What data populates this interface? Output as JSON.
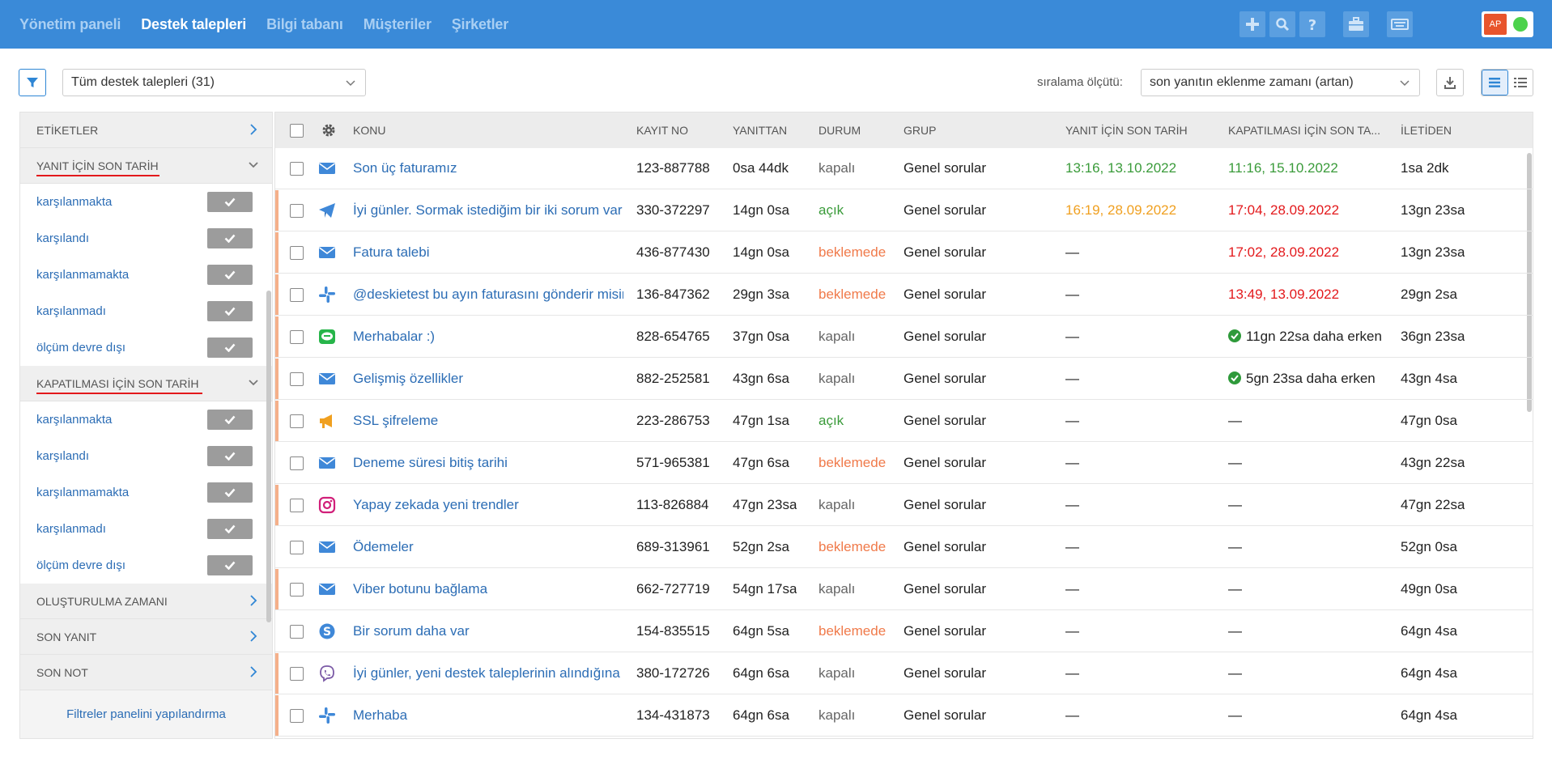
{
  "nav": {
    "items": [
      "Yönetim paneli",
      "Destek talepleri",
      "Bilgi tabanı",
      "Müşteriler",
      "Şirketler"
    ],
    "active_index": 1
  },
  "header_icons": [
    "plus-icon",
    "search-icon",
    "help-icon",
    "briefcase-icon",
    "keyboard-icon"
  ],
  "user": {
    "initials": "AP",
    "status": "online"
  },
  "filter_select": {
    "value": "Tüm destek talepleri (31)"
  },
  "sort": {
    "label": "sıralama ölçütü:",
    "value": "son yanıtın eklenme zamanı (artan)"
  },
  "sidebar": {
    "sections": [
      {
        "title": "ETİKETLER",
        "expanded": false,
        "underlined": false
      },
      {
        "title": "YANIT İÇİN SON TARİH",
        "expanded": true,
        "underlined": true,
        "items": [
          "karşılanmakta",
          "karşılandı",
          "karşılanmamakta",
          "karşılanmadı",
          "ölçüm devre dışı"
        ]
      },
      {
        "title": "KAPATILMASI İÇİN SON TARİH",
        "expanded": true,
        "underlined": true,
        "items": [
          "karşılanmakta",
          "karşılandı",
          "karşılanmamakta",
          "karşılanmadı",
          "ölçüm devre dışı"
        ]
      },
      {
        "title": "OLUŞTURULMA ZAMANI",
        "expanded": false,
        "underlined": false
      },
      {
        "title": "SON YANIT",
        "expanded": false,
        "underlined": false
      },
      {
        "title": "SON NOT",
        "expanded": false,
        "underlined": false
      }
    ],
    "footer": "Filtreler panelini yapılandırma"
  },
  "table": {
    "headers": {
      "subject": "KONU",
      "id": "KAYIT NO",
      "answered": "YANITTAN",
      "status": "DURUM",
      "group": "GRUP",
      "reply_due": "YANIT İÇİN SON TARİH",
      "close_due": "KAPATILMASI İÇİN SON TA...",
      "updated": "İLETİDEN"
    },
    "colors": {
      "link": "#2c6db5",
      "green": "#3a9b3a",
      "orange": "#f0a020",
      "red": "#e3191c",
      "pending": "#f07a4a",
      "closed": "#666666"
    },
    "rows": [
      {
        "channel": "email-icon",
        "marked": false,
        "subject": "Son üç faturamız",
        "id": "123-887788",
        "answered": "0sa 44dk",
        "status": "kapalı",
        "status_color": "closed",
        "group": "Genel sorular",
        "reply_due": "13:16, 13.10.2022",
        "reply_color": "green",
        "close_due": "11:16, 15.10.2022",
        "close_color": "green",
        "close_ok": false,
        "updated": "1sa 2dk"
      },
      {
        "channel": "telegram-icon",
        "marked": true,
        "subject": "İyi günler. Sormak istediğim bir iki sorum var",
        "id": "330-372297",
        "answered": "14gn 0sa",
        "status": "açık",
        "status_color": "green",
        "group": "Genel sorular",
        "reply_due": "16:19, 28.09.2022",
        "reply_color": "orange",
        "close_due": "17:04, 28.09.2022",
        "close_color": "red",
        "close_ok": false,
        "updated": "13gn 23sa"
      },
      {
        "channel": "email-icon",
        "marked": true,
        "subject": "Fatura talebi",
        "id": "436-877430",
        "answered": "14gn 0sa",
        "status": "beklemede",
        "status_color": "pending",
        "group": "Genel sorular",
        "reply_due": "—",
        "reply_color": "",
        "close_due": "17:02, 28.09.2022",
        "close_color": "red",
        "close_ok": false,
        "updated": "13gn 23sa"
      },
      {
        "channel": "slack-icon",
        "marked": true,
        "subject": "@deskietest bu ayın faturasını gönderir misiniz",
        "id": "136-847362",
        "answered": "29gn 3sa",
        "status": "beklemede",
        "status_color": "pending",
        "group": "Genel sorular",
        "reply_due": "—",
        "reply_color": "",
        "close_due": "13:49, 13.09.2022",
        "close_color": "red",
        "close_ok": false,
        "updated": "29gn 2sa"
      },
      {
        "channel": "line-icon",
        "marked": true,
        "subject": "Merhabalar :)",
        "id": "828-654765",
        "answered": "37gn 0sa",
        "status": "kapalı",
        "status_color": "closed",
        "group": "Genel sorular",
        "reply_due": "—",
        "reply_color": "",
        "close_due": "11gn 22sa daha erken",
        "close_color": "",
        "close_ok": true,
        "updated": "36gn 23sa"
      },
      {
        "channel": "email-icon",
        "marked": true,
        "subject": "Gelişmiş özellikler",
        "id": "882-252581",
        "answered": "43gn 6sa",
        "status": "kapalı",
        "status_color": "closed",
        "group": "Genel sorular",
        "reply_due": "—",
        "reply_color": "",
        "close_due": "5gn 23sa daha erken",
        "close_color": "",
        "close_ok": true,
        "updated": "43gn 4sa"
      },
      {
        "channel": "megaphone-icon",
        "marked": true,
        "subject": "SSL şifreleme",
        "id": "223-286753",
        "answered": "47gn 1sa",
        "status": "açık",
        "status_color": "green",
        "group": "Genel sorular",
        "reply_due": "—",
        "reply_color": "",
        "close_due": "—",
        "close_color": "",
        "close_ok": false,
        "updated": "47gn 0sa"
      },
      {
        "channel": "email-icon",
        "marked": false,
        "subject": "Deneme süresi bitiş tarihi",
        "id": "571-965381",
        "answered": "47gn 6sa",
        "status": "beklemede",
        "status_color": "pending",
        "group": "Genel sorular",
        "reply_due": "—",
        "reply_color": "",
        "close_due": "—",
        "close_color": "",
        "close_ok": false,
        "updated": "43gn 22sa"
      },
      {
        "channel": "instagram-icon",
        "marked": true,
        "subject": "Yapay zekada yeni trendler",
        "id": "113-826884",
        "answered": "47gn 23sa",
        "status": "kapalı",
        "status_color": "closed",
        "group": "Genel sorular",
        "reply_due": "—",
        "reply_color": "",
        "close_due": "—",
        "close_color": "",
        "close_ok": false,
        "updated": "47gn 22sa"
      },
      {
        "channel": "email-icon",
        "marked": false,
        "subject": "Ödemeler",
        "id": "689-313961",
        "answered": "52gn 2sa",
        "status": "beklemede",
        "status_color": "pending",
        "group": "Genel sorular",
        "reply_due": "—",
        "reply_color": "",
        "close_due": "—",
        "close_color": "",
        "close_ok": false,
        "updated": "52gn 0sa"
      },
      {
        "channel": "email-icon",
        "marked": true,
        "subject": "Viber botunu bağlama",
        "id": "662-727719",
        "answered": "54gn 17sa",
        "status": "kapalı",
        "status_color": "closed",
        "group": "Genel sorular",
        "reply_due": "—",
        "reply_color": "",
        "close_due": "—",
        "close_color": "",
        "close_ok": false,
        "updated": "49gn 0sa"
      },
      {
        "channel": "skype-icon",
        "marked": false,
        "subject": "Bir sorum daha var",
        "id": "154-835515",
        "answered": "64gn 5sa",
        "status": "beklemede",
        "status_color": "pending",
        "group": "Genel sorular",
        "reply_due": "—",
        "reply_color": "",
        "close_due": "—",
        "close_color": "",
        "close_ok": false,
        "updated": "64gn 4sa"
      },
      {
        "channel": "viber-icon",
        "marked": true,
        "subject": "İyi günler, yeni destek taleplerinin alındığına dair",
        "id": "380-172726",
        "answered": "64gn 6sa",
        "status": "kapalı",
        "status_color": "closed",
        "group": "Genel sorular",
        "reply_due": "—",
        "reply_color": "",
        "close_due": "—",
        "close_color": "",
        "close_ok": false,
        "updated": "64gn 4sa"
      },
      {
        "channel": "slack-icon",
        "marked": true,
        "subject": "Merhaba",
        "id": "134-431873",
        "answered": "64gn 6sa",
        "status": "kapalı",
        "status_color": "closed",
        "group": "Genel sorular",
        "reply_due": "—",
        "reply_color": "",
        "close_due": "—",
        "close_color": "",
        "close_ok": false,
        "updated": "64gn 4sa"
      }
    ]
  }
}
